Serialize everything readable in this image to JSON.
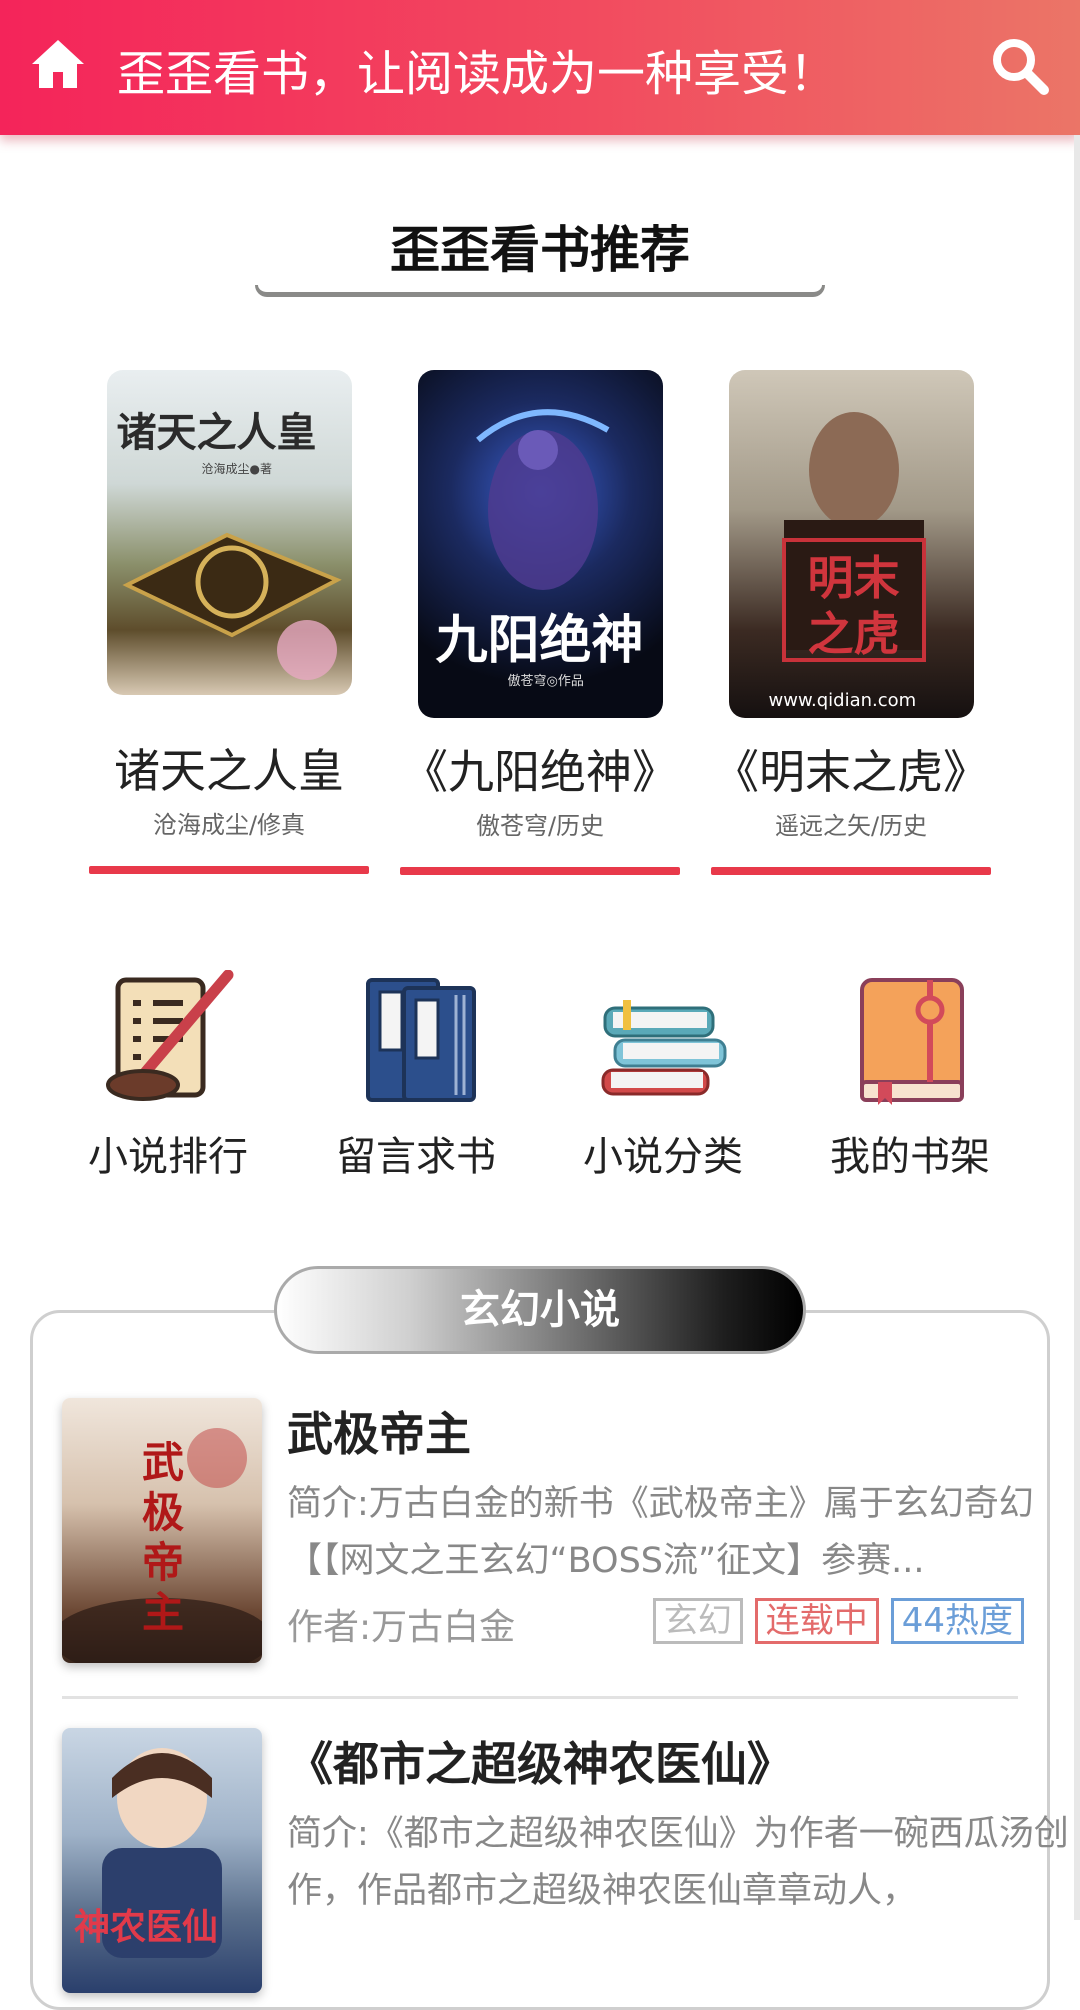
{
  "header": {
    "slogan": "歪歪看书，让阅读成为一种享受！",
    "home_icon": "home-icon",
    "search_icon": "search-icon"
  },
  "recommend": {
    "title": "歪歪看书推荐",
    "books": [
      {
        "title": "诸天之人皇",
        "meta": "沧海成尘/修真",
        "cover_text": "诸天之人皇",
        "cover_sub": "沧海成尘●著"
      },
      {
        "title": "《九阳绝神》",
        "meta": "傲苍穹/历史",
        "cover_text": "九阳绝神",
        "cover_sub": "傲苍穹◎作品"
      },
      {
        "title": "《明末之虎》",
        "meta": "遥远之矢/历史",
        "cover_text": "明末之虎",
        "cover_sub": "www.qidian.com"
      }
    ]
  },
  "categories": [
    {
      "label": "小说排行",
      "icon": "scroll-quill-icon"
    },
    {
      "label": "留言求书",
      "icon": "books-bound-icon"
    },
    {
      "label": "小说分类",
      "icon": "book-stack-icon"
    },
    {
      "label": "我的书架",
      "icon": "notebook-icon"
    }
  ],
  "section": {
    "title": "玄幻小说",
    "items": [
      {
        "title": "武极帝主",
        "desc": "简介:万古白金的新书《武极帝主》属于玄幻奇幻【【网文之王玄幻“BOSS流”征文】参赛...",
        "author": "作者:万古白金",
        "tags": [
          {
            "text": "玄幻",
            "color": "#bbbbbb"
          },
          {
            "text": "连载中",
            "color": "#e36b6b"
          },
          {
            "text": "44热度",
            "color": "#6b9ed8"
          }
        ],
        "cover_text": "武极帝主"
      },
      {
        "title": "《都市之超级神农医仙》",
        "desc": "简介:《都市之超级神农医仙》为作者一碗西瓜汤创作，作品都市之超级神农医仙章章动人，",
        "cover_text": "神农医仙"
      }
    ]
  },
  "colors": {
    "header_start": "#f4245a",
    "header_end": "#eb7567",
    "accent_bar": "#e8394a"
  }
}
